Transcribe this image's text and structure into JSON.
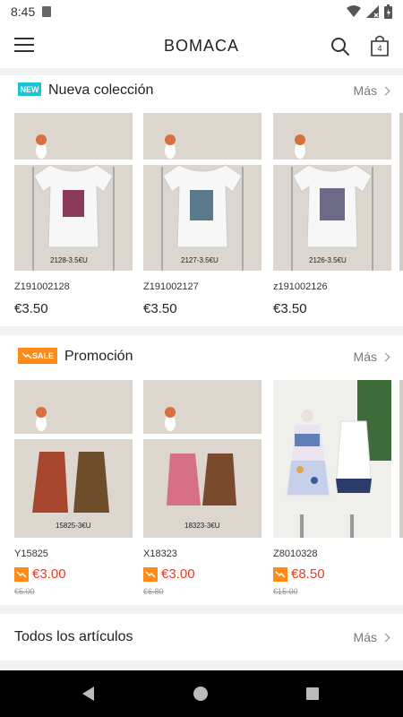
{
  "status": {
    "time": "8:45"
  },
  "app": {
    "title": "BOMACA",
    "cart_count": "4"
  },
  "sections": {
    "new": {
      "badge": "NEW",
      "title": "Nueva colección",
      "more": "Más",
      "items": [
        {
          "code": "Z191002128",
          "price": "€3.50",
          "tag": "2128-3.5€U"
        },
        {
          "code": "Z191002127",
          "price": "€3.50",
          "tag": "2127-3.5€U"
        },
        {
          "code": "z191002126",
          "price": "€3.50",
          "tag": "2126-3.5€U"
        }
      ]
    },
    "promo": {
      "badge": "SALE",
      "title": "Promoción",
      "more": "Más",
      "items": [
        {
          "code": "Y15825",
          "price": "€3.00",
          "old_price": "€5.00",
          "tag": "15825-3€U"
        },
        {
          "code": "X18323",
          "price": "€3.00",
          "old_price": "€6.80",
          "tag": "18323-3€U"
        },
        {
          "code": "Z8010328",
          "price": "€8.50",
          "old_price": "€15.00",
          "tag": ""
        }
      ]
    },
    "all": {
      "title": "Todos los artículos",
      "more": "Más"
    }
  },
  "colors": {
    "new_badge": "#19c4d3",
    "sale_badge": "#ff8b16",
    "promo_price": "#e83c22"
  }
}
